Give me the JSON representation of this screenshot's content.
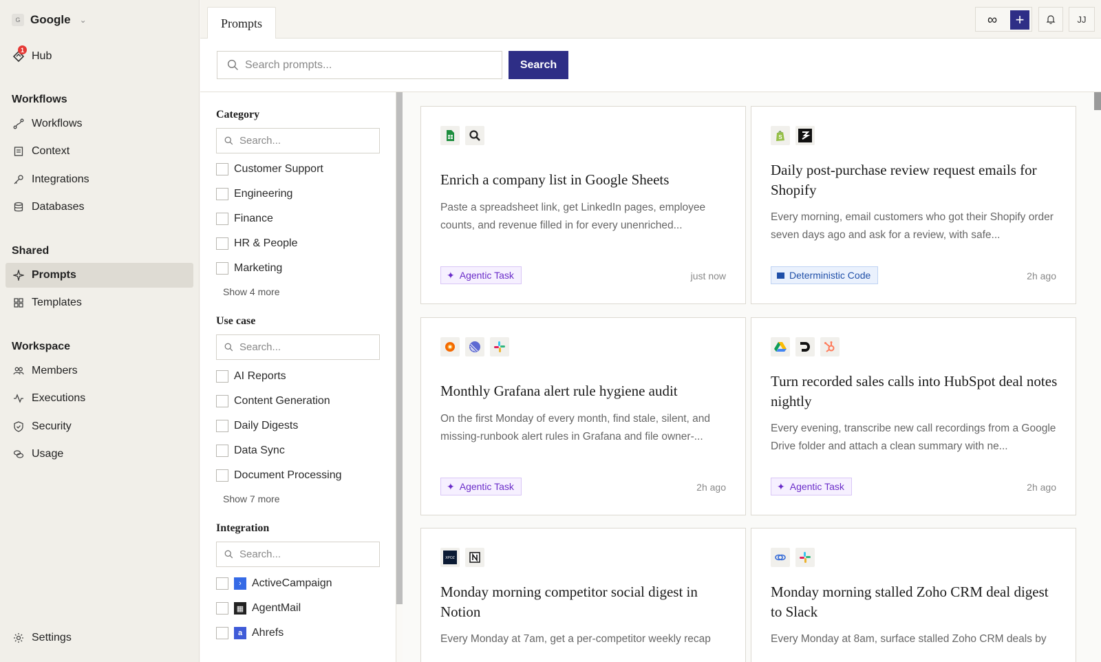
{
  "org": {
    "badge": "G",
    "name": "Google"
  },
  "hub": {
    "label": "Hub",
    "badge": "1"
  },
  "sections": {
    "workflows": "Workflows",
    "shared": "Shared",
    "workspace": "Workspace"
  },
  "nav": {
    "workflows": "Workflows",
    "context": "Context",
    "integrations": "Integrations",
    "databases": "Databases",
    "prompts": "Prompts",
    "templates": "Templates",
    "members": "Members",
    "executions": "Executions",
    "security": "Security",
    "usage": "Usage",
    "settings": "Settings"
  },
  "topbar": {
    "tab": "Prompts",
    "avatar": "JJ"
  },
  "search": {
    "placeholder": "Search prompts...",
    "button": "Search"
  },
  "filters": {
    "category": {
      "title": "Category",
      "placeholder": "Search...",
      "options": [
        "Customer Support",
        "Engineering",
        "Finance",
        "HR & People",
        "Marketing"
      ],
      "more": "Show 4 more"
    },
    "use_case": {
      "title": "Use case",
      "placeholder": "Search...",
      "options": [
        "AI Reports",
        "Content Generation",
        "Daily Digests",
        "Data Sync",
        "Document Processing"
      ],
      "more": "Show 7 more"
    },
    "integration": {
      "title": "Integration",
      "placeholder": "Search...",
      "options": [
        "ActiveCampaign",
        "AgentMail",
        "Ahrefs"
      ]
    }
  },
  "cards": [
    {
      "title": "Enrich a company list in Google Sheets",
      "desc": "Paste a spreadsheet link, get LinkedIn pages, employee counts, and revenue filled in for every unenriched...",
      "tag": "Agentic Task",
      "time": "just now"
    },
    {
      "title": "Daily post-purchase review request emails for Shopify",
      "desc": "Every morning, email customers who got their Shopify order seven days ago and ask for a review, with safe...",
      "tag": "Deterministic Code",
      "time": "2h ago"
    },
    {
      "title": "Monthly Grafana alert rule hygiene audit",
      "desc": "On the first Monday of every month, find stale, silent, and missing-runbook alert rules in Grafana and file owner-...",
      "tag": "Agentic Task",
      "time": "2h ago"
    },
    {
      "title": "Turn recorded sales calls into HubSpot deal notes nightly",
      "desc": "Every evening, transcribe new call recordings from a Google Drive folder and attach a clean summary with ne...",
      "tag": "Agentic Task",
      "time": "2h ago"
    },
    {
      "title": "Monday morning competitor social digest in Notion",
      "desc": "Every Monday at 7am, get a per-competitor weekly recap",
      "tag": "",
      "time": ""
    },
    {
      "title": "Monday morning stalled Zoho CRM deal digest to Slack",
      "desc": "Every Monday at 8am, surface stalled Zoho CRM deals by",
      "tag": "",
      "time": ""
    }
  ],
  "icons": {
    "card1": [
      "google-sheets-icon",
      "search-icon"
    ],
    "card2": [
      "shopify-icon",
      "retool-icon"
    ],
    "card3": [
      "grafana-icon",
      "linear-icon",
      "slack-icon"
    ],
    "card4": [
      "google-drive-icon",
      "deepgram-icon",
      "hubspot-icon"
    ],
    "card5": [
      "xpoz-icon",
      "notion-icon"
    ],
    "card6": [
      "zoho-icon",
      "slack-icon"
    ]
  },
  "xpoz_label": "XPOZ",
  "colors": {
    "accent": "#2e2e86",
    "agentic": "#6a2cc9",
    "deterministic": "#1f4fa8",
    "badge_red": "#e53935"
  }
}
